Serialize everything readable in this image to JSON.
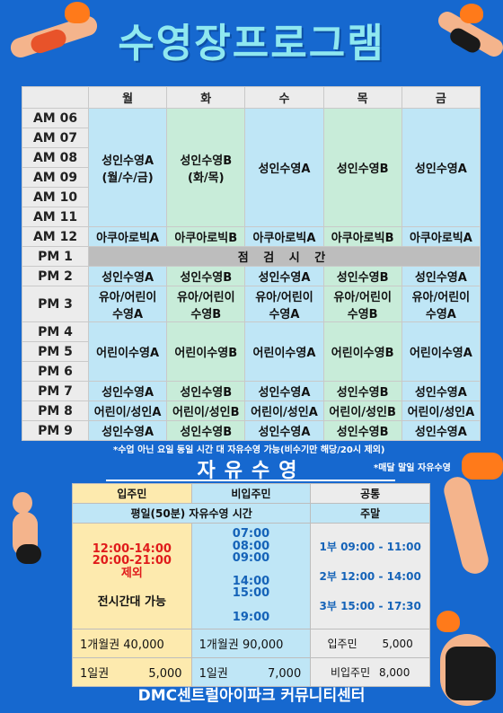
{
  "title": "수영장프로그램",
  "days": [
    "월",
    "화",
    "수",
    "목",
    "금"
  ],
  "times": [
    "AM 06",
    "AM 07",
    "AM 08",
    "AM 09",
    "AM 10",
    "AM 11",
    "AM 12",
    "PM 1",
    "PM 2",
    "PM 3",
    "PM 4",
    "PM 5",
    "PM 6",
    "PM 7",
    "PM 8",
    "PM 9"
  ],
  "morning": {
    "mon": "성인수영A\n(월/수/금)",
    "tue": "성인수영B\n(화/목)",
    "wed": "성인수영A",
    "thu": "성인수영B",
    "fri": "성인수영A"
  },
  "aqua": {
    "a": "아쿠아로빅A",
    "b": "아쿠아로빅B"
  },
  "inspection": "점 검 시 간",
  "adult_a": "성인수영A",
  "adult_b": "성인수영B",
  "kids_a": "유아/어린이\n수영A",
  "kids_b": "유아/어린이\n수영B",
  "child_a": "어린이수영A",
  "child_b": "어린이수영B",
  "pm8_a": "어린이/성인A",
  "pm8_b": "어린이/성인B",
  "note1": "*수업 아닌 요일 동일 시간 대 자유수영 가능(비수기만 해당/20시 제외)",
  "note2": "*매달 말일 자유수영",
  "free_title": "자유수영",
  "free": {
    "h_resident": "입주민",
    "h_nonresident": "비입주민",
    "h_common": "공통",
    "sub_weekday": "평일(50분) 자유수영 시간",
    "sub_weekend": "주말",
    "res_excl": "12:00-14:00\n20:00-21:00\n제외",
    "res_all": "전시간대 가능",
    "non_times_1": "07:00\n08:00\n09:00",
    "non_times_2": "14:00\n15:00",
    "non_times_3": "19:00",
    "weekend_1": "1부 09:00 - 11:00",
    "weekend_2": "2부 12:00 - 14:00",
    "weekend_3": "3부 15:00 - 17:30",
    "res_month": "1개월권 40,000",
    "res_day_label": "1일권",
    "res_day_price": "5,000",
    "non_month": "1개월권 90,000",
    "non_day_label": "1일권",
    "non_day_price": "7,000",
    "com_res_label": "입주민",
    "com_res_price": "5,000",
    "com_non_label": "비입주민",
    "com_non_price": "8,000"
  },
  "footer": "DMC센트럴아이파크 커뮤니티센터"
}
